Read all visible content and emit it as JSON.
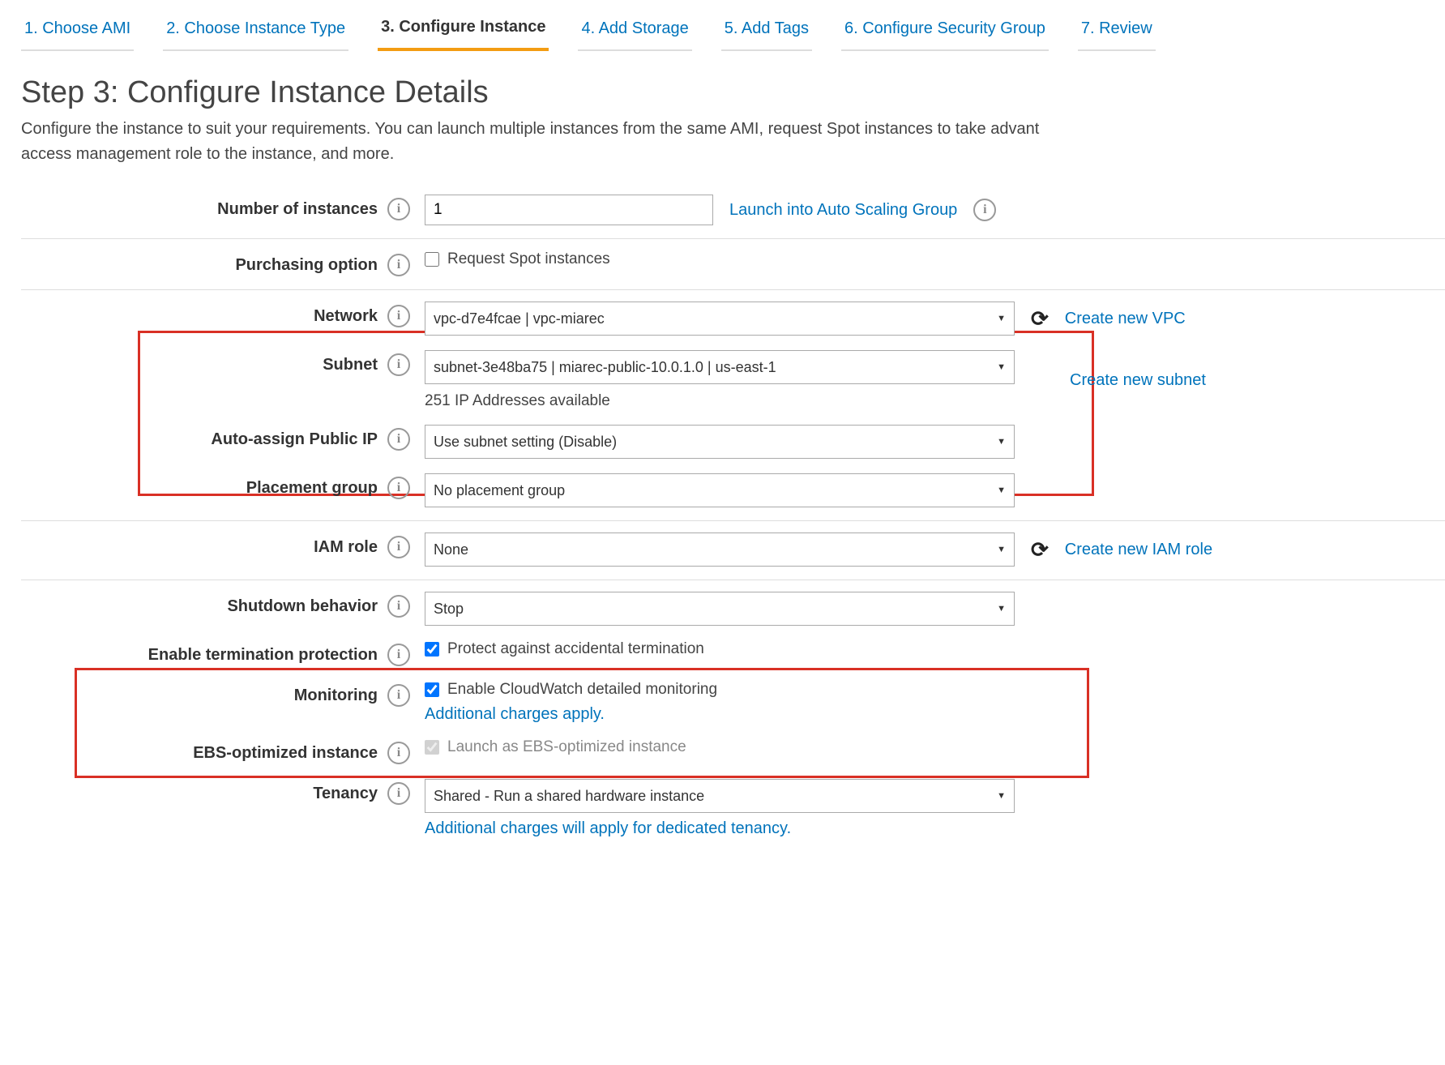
{
  "wizard": {
    "steps": [
      "1. Choose AMI",
      "2. Choose Instance Type",
      "3. Configure Instance",
      "4. Add Storage",
      "5. Add Tags",
      "6. Configure Security Group",
      "7. Review"
    ],
    "active_index": 2
  },
  "heading": {
    "title": "Step 3: Configure Instance Details",
    "subtitle_line1": "Configure the instance to suit your requirements. You can launch multiple instances from the same AMI, request Spot instances to take advant",
    "subtitle_line2": "access management role to the instance, and more."
  },
  "fields": {
    "num_instances": {
      "label": "Number of instances",
      "value": "1",
      "link": "Launch into Auto Scaling Group"
    },
    "purchasing_option": {
      "label": "Purchasing option",
      "checkbox_label": "Request Spot instances",
      "checked": false
    },
    "network": {
      "label": "Network",
      "value": "vpc-d7e4fcae | vpc-miarec",
      "link": "Create new VPC"
    },
    "subnet": {
      "label": "Subnet",
      "value": "subnet-3e48ba75 | miarec-public-10.0.1.0 | us-east-1",
      "helper": "251 IP Addresses available",
      "link": "Create new subnet"
    },
    "auto_assign_ip": {
      "label": "Auto-assign Public IP",
      "value": "Use subnet setting (Disable)"
    },
    "placement_group": {
      "label": "Placement group",
      "value": "No placement group"
    },
    "iam_role": {
      "label": "IAM role",
      "value": "None",
      "link": "Create new IAM role"
    },
    "shutdown_behavior": {
      "label": "Shutdown behavior",
      "value": "Stop"
    },
    "termination_protection": {
      "label": "Enable termination protection",
      "checkbox_label": "Protect against accidental termination",
      "checked": true
    },
    "monitoring": {
      "label": "Monitoring",
      "checkbox_label": "Enable CloudWatch detailed monitoring",
      "checked": true,
      "sub_link": "Additional charges apply."
    },
    "ebs_optimized": {
      "label": "EBS-optimized instance",
      "checkbox_label": "Launch as EBS-optimized instance",
      "checked": true,
      "disabled": true
    },
    "tenancy": {
      "label": "Tenancy",
      "value": "Shared - Run a shared hardware instance",
      "sub_link": "Additional charges will apply for dedicated tenancy."
    }
  }
}
